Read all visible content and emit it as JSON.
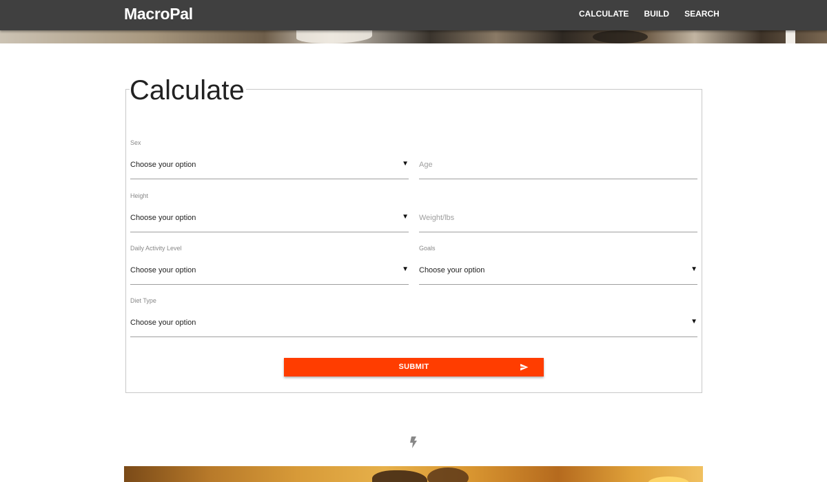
{
  "app": {
    "brand": "MacroPal"
  },
  "nav": {
    "items": [
      {
        "label": "CALCULATE"
      },
      {
        "label": "BUILD"
      },
      {
        "label": "SEARCH"
      }
    ]
  },
  "form": {
    "title": "Calculate",
    "fields": {
      "sex": {
        "label": "Sex",
        "value": "Choose your option"
      },
      "age": {
        "placeholder": "Age"
      },
      "height": {
        "label": "Height",
        "value": "Choose your option"
      },
      "weight": {
        "placeholder": "Weight/lbs"
      },
      "activity": {
        "label": "Daily Activity Level",
        "value": "Choose your option"
      },
      "goals": {
        "label": "Goals",
        "value": "Choose your option"
      },
      "diet": {
        "label": "Diet Type",
        "value": "Choose your option"
      }
    },
    "submit_label": "SUBMIT"
  },
  "icons": {
    "dropdown": "chevron-down-icon",
    "submit": "send-icon",
    "divider": "bolt-icon"
  },
  "colors": {
    "navbar_bg": "#404040",
    "accent": "#ff3d00",
    "field_border": "#9e9e9e"
  }
}
